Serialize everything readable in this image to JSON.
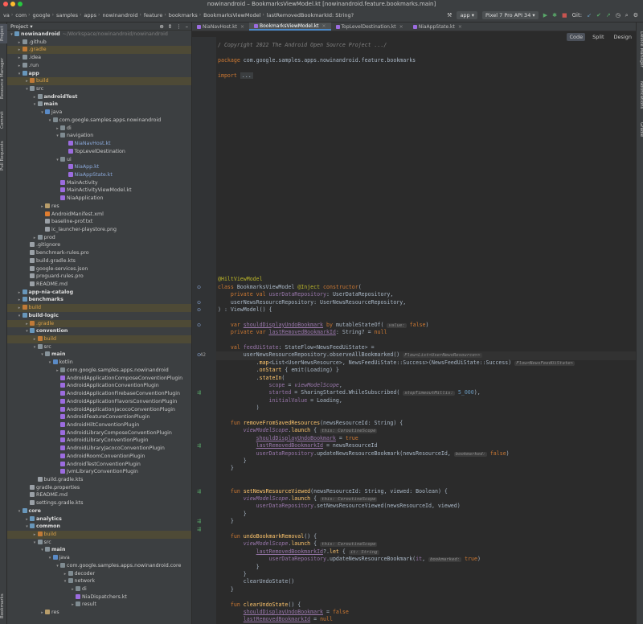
{
  "window": {
    "title": "nowinandroid – BookmarksViewModel.kt [nowinandroid.feature.bookmarks.main]"
  },
  "breadcrumbs": [
    "va",
    "com",
    "google",
    "samples",
    "apps",
    "nowinandroid",
    "feature",
    "bookmarks",
    "BookmarksViewModel",
    "lastRemovedBookmarkId: String?"
  ],
  "toolbar": {
    "run_config": "app",
    "device": "Pixel 7 Pro API 34",
    "git_label": "Git:"
  },
  "left_tabs": [
    "Project",
    "Resource Manager",
    "Commit",
    "Pull Requests",
    "Bookmarks"
  ],
  "right_tabs": [
    "Device Manager",
    "Notifications",
    "Gradle"
  ],
  "project": {
    "header": "Project",
    "tree": [
      {
        "d": 0,
        "n": "nowinandroid",
        "t": "mod",
        "h": "~/Workspace/nowinandroid/nowinandroid",
        "o": true,
        "b": true
      },
      {
        "d": 1,
        "n": ".github",
        "t": "folder",
        "o": false
      },
      {
        "d": 1,
        "n": ".gradle",
        "t": "build",
        "o": false,
        "cls": "orange",
        "x": true
      },
      {
        "d": 1,
        "n": ".idea",
        "t": "folder",
        "o": false
      },
      {
        "d": 1,
        "n": ".run",
        "t": "folder",
        "o": false
      },
      {
        "d": 1,
        "n": "app",
        "t": "mod",
        "o": true,
        "b": true
      },
      {
        "d": 2,
        "n": "build",
        "t": "build",
        "o": false,
        "cls": "orange",
        "x": true
      },
      {
        "d": 2,
        "n": "src",
        "t": "folder",
        "o": true
      },
      {
        "d": 3,
        "n": "androidTest",
        "t": "folder",
        "o": false,
        "b": true
      },
      {
        "d": 3,
        "n": "main",
        "t": "folder",
        "o": true,
        "b": true
      },
      {
        "d": 4,
        "n": "java",
        "t": "src",
        "o": true
      },
      {
        "d": 5,
        "n": "com.google.samples.apps.nowinandroid",
        "t": "pkg",
        "o": true
      },
      {
        "d": 6,
        "n": "di",
        "t": "pkg",
        "o": false
      },
      {
        "d": 6,
        "n": "navigation",
        "t": "pkg",
        "o": true
      },
      {
        "d": 7,
        "n": "NiaNavHost.kt",
        "t": "kt",
        "cls": "blue",
        "leaf": true
      },
      {
        "d": 7,
        "n": "TopLevelDestination",
        "t": "kt",
        "leaf": true
      },
      {
        "d": 6,
        "n": "ui",
        "t": "pkg",
        "o": true
      },
      {
        "d": 7,
        "n": "NiaApp.kt",
        "t": "kt",
        "cls": "blue",
        "leaf": true
      },
      {
        "d": 7,
        "n": "NiaAppState.kt",
        "t": "kt",
        "cls": "blue",
        "leaf": true
      },
      {
        "d": 6,
        "n": "MainActivity",
        "t": "kt",
        "leaf": true
      },
      {
        "d": 6,
        "n": "MainActivityViewModel.kt",
        "t": "kt",
        "leaf": true
      },
      {
        "d": 6,
        "n": "NiaApplication",
        "t": "kt",
        "leaf": true
      },
      {
        "d": 4,
        "n": "res",
        "t": "res",
        "o": false
      },
      {
        "d": 4,
        "n": "AndroidManifest.xml",
        "t": "xml",
        "leaf": true
      },
      {
        "d": 4,
        "n": "baseline-prof.txt",
        "t": "file",
        "leaf": true
      },
      {
        "d": 4,
        "n": "ic_launcher-playstore.png",
        "t": "file",
        "leaf": true
      },
      {
        "d": 3,
        "n": "prod",
        "t": "folder",
        "o": false
      },
      {
        "d": 2,
        "n": ".gitignore",
        "t": "file",
        "leaf": true
      },
      {
        "d": 2,
        "n": "benchmark-rules.pro",
        "t": "file",
        "leaf": true
      },
      {
        "d": 2,
        "n": "build.gradle.kts",
        "t": "file",
        "leaf": true
      },
      {
        "d": 2,
        "n": "google-services.json",
        "t": "file",
        "leaf": true
      },
      {
        "d": 2,
        "n": "proguard-rules.pro",
        "t": "file",
        "leaf": true
      },
      {
        "d": 2,
        "n": "README.md",
        "t": "file",
        "leaf": true
      },
      {
        "d": 1,
        "n": "app-nia-catalog",
        "t": "mod",
        "o": false,
        "b": true
      },
      {
        "d": 1,
        "n": "benchmarks",
        "t": "mod",
        "o": false,
        "b": true
      },
      {
        "d": 1,
        "n": "build",
        "t": "build",
        "o": false,
        "cls": "orange",
        "x": true
      },
      {
        "d": 1,
        "n": "build-logic",
        "t": "mod",
        "o": true,
        "b": true
      },
      {
        "d": 2,
        "n": ".gradle",
        "t": "build",
        "o": false,
        "cls": "orange",
        "x": true
      },
      {
        "d": 2,
        "n": "convention",
        "t": "mod",
        "o": true,
        "b": true
      },
      {
        "d": 3,
        "n": "build",
        "t": "build",
        "o": false,
        "cls": "orange",
        "x": true
      },
      {
        "d": 3,
        "n": "src",
        "t": "folder",
        "o": true
      },
      {
        "d": 4,
        "n": "main",
        "t": "folder",
        "o": true,
        "b": true
      },
      {
        "d": 5,
        "n": "kotlin",
        "t": "src",
        "o": true
      },
      {
        "d": 6,
        "n": "com.google.samples.apps.nowinandroid",
        "t": "pkg",
        "o": false
      },
      {
        "d": 6,
        "n": "AndroidApplicationComposeConventionPlugin",
        "t": "kt",
        "leaf": true
      },
      {
        "d": 6,
        "n": "AndroidApplicationConventionPlugin",
        "t": "kt",
        "leaf": true
      },
      {
        "d": 6,
        "n": "AndroidApplicationFirebaseConventionPlugin",
        "t": "kt",
        "leaf": true
      },
      {
        "d": 6,
        "n": "AndroidApplicationFlavorsConventionPlugin",
        "t": "kt",
        "leaf": true
      },
      {
        "d": 6,
        "n": "AndroidApplicationJacocoConventionPlugin",
        "t": "kt",
        "leaf": true
      },
      {
        "d": 6,
        "n": "AndroidFeatureConventionPlugin",
        "t": "kt",
        "leaf": true
      },
      {
        "d": 6,
        "n": "AndroidHiltConventionPlugin",
        "t": "kt",
        "leaf": true
      },
      {
        "d": 6,
        "n": "AndroidLibraryComposeConventionPlugin",
        "t": "kt",
        "leaf": true
      },
      {
        "d": 6,
        "n": "AndroidLibraryConventionPlugin",
        "t": "kt",
        "leaf": true
      },
      {
        "d": 6,
        "n": "AndroidLibraryJacocoConventionPlugin",
        "t": "kt",
        "leaf": true
      },
      {
        "d": 6,
        "n": "AndroidRoomConventionPlugin",
        "t": "kt",
        "leaf": true
      },
      {
        "d": 6,
        "n": "AndroidTestConventionPlugin",
        "t": "kt",
        "leaf": true
      },
      {
        "d": 6,
        "n": "JvmLibraryConventionPlugin",
        "t": "kt",
        "leaf": true
      },
      {
        "d": 3,
        "n": "build.gradle.kts",
        "t": "file",
        "leaf": true
      },
      {
        "d": 2,
        "n": "gradle.properties",
        "t": "file",
        "leaf": true
      },
      {
        "d": 2,
        "n": "README.md",
        "t": "file",
        "leaf": true
      },
      {
        "d": 2,
        "n": "settings.gradle.kts",
        "t": "file",
        "leaf": true
      },
      {
        "d": 1,
        "n": "core",
        "t": "mod",
        "o": true,
        "b": true
      },
      {
        "d": 2,
        "n": "analytics",
        "t": "mod",
        "o": false,
        "b": true
      },
      {
        "d": 2,
        "n": "common",
        "t": "mod",
        "o": true,
        "b": true
      },
      {
        "d": 3,
        "n": "build",
        "t": "build",
        "o": false,
        "cls": "orange",
        "x": true
      },
      {
        "d": 3,
        "n": "src",
        "t": "folder",
        "o": true
      },
      {
        "d": 4,
        "n": "main",
        "t": "folder",
        "o": true,
        "b": true
      },
      {
        "d": 5,
        "n": "java",
        "t": "src",
        "o": true
      },
      {
        "d": 6,
        "n": "com.google.samples.apps.nowinandroid.core",
        "t": "pkg",
        "o": true
      },
      {
        "d": 7,
        "n": "decoder",
        "t": "pkg",
        "o": false
      },
      {
        "d": 7,
        "n": "network",
        "t": "pkg",
        "o": true
      },
      {
        "d": 8,
        "n": "di",
        "t": "pkg",
        "o": false
      },
      {
        "d": 8,
        "n": "NiaDispatchers.kt",
        "t": "kt",
        "leaf": true
      },
      {
        "d": 8,
        "n": "result",
        "t": "pkg",
        "o": false
      },
      {
        "d": 4,
        "n": "res",
        "t": "res",
        "o": false
      }
    ]
  },
  "tabs": [
    {
      "label": "NiaNavHost.kt",
      "active": false
    },
    {
      "label": "BookmarksViewModel.kt",
      "active": true
    },
    {
      "label": "TopLevelDestination.kt",
      "active": false
    },
    {
      "label": "NiaAppState.kt",
      "active": false
    }
  ],
  "view_modes": [
    "Code",
    "Split",
    "Design"
  ],
  "code": {
    "first_line": 1,
    "current_line": 42,
    "lines": [
      [
        [
          "c",
          "/ Copyright 2022 The Android Open Source Project .../"
        ]
      ],
      [],
      [
        [
          "k",
          "package "
        ],
        [
          "t",
          "com.google.samples.apps.nowinandroid.feature.bookmarks"
        ]
      ],
      [],
      [
        [
          "k",
          "import "
        ],
        [
          "fold",
          "..."
        ]
      ],
      [],
      [],
      [],
      [],
      [],
      [],
      [],
      [],
      [],
      [],
      [],
      [],
      [],
      [],
      [],
      [],
      [],
      [],
      [],
      [],
      [],
      [],
      [],
      [],
      [],
      [],
      [
        [
          "a",
          "@HiltViewModel"
        ]
      ],
      [
        [
          "k",
          "class "
        ],
        [
          "t",
          "BookmarksViewModel "
        ],
        [
          "a",
          "@Inject "
        ],
        [
          "k",
          "constructor"
        ],
        [
          "t",
          "("
        ]
      ],
      [
        [
          "t",
          "    "
        ],
        [
          "k",
          "private val "
        ],
        [
          "p",
          "userDataRepository"
        ],
        [
          "t",
          ": UserDataRepository,"
        ]
      ],
      [
        [
          "t",
          "    userNewsResourceRepository: UserNewsResourceRepository,"
        ]
      ],
      [
        [
          "t",
          ") : ViewModel() {"
        ]
      ],
      [],
      [
        [
          "t",
          "    "
        ],
        [
          "k",
          "var "
        ],
        [
          "pu",
          "shouldDisplayUndoBookmark"
        ],
        [
          "t",
          " "
        ],
        [
          "k",
          "by "
        ],
        [
          "t",
          "mutableStateOf( "
        ],
        [
          "hl",
          "value:"
        ],
        [
          "t",
          " "
        ],
        [
          "k",
          "false"
        ],
        [
          "t",
          ")"
        ]
      ],
      [
        [
          "t",
          "    "
        ],
        [
          "k",
          "private var "
        ],
        [
          "pu",
          "lastRemovedBookmarkId"
        ],
        [
          "t",
          ": String? = "
        ],
        [
          "k",
          "null"
        ]
      ],
      [],
      [
        [
          "t",
          "    "
        ],
        [
          "k",
          "val "
        ],
        [
          "p",
          "feedUiState"
        ],
        [
          "t",
          ": StateFlow<NewsFeedUiState> ="
        ]
      ],
      [
        [
          "t",
          "        userNewsResourceRepository.observeAllBookmarked() "
        ],
        [
          "hl",
          "Flow<List<UserNewsResource>>"
        ]
      ],
      [
        [
          "t",
          "            ."
        ],
        [
          "f",
          "map"
        ],
        [
          "t",
          "<List<UserNewsResource>, NewsFeedUiState::Success>(NewsFeedUiState::Success) "
        ],
        [
          "hl",
          "Flow<NewsFeedUiState>"
        ]
      ],
      [
        [
          "t",
          "            ."
        ],
        [
          "f",
          "onStart"
        ],
        [
          "t",
          " { emit(Loading) }"
        ]
      ],
      [
        [
          "t",
          "            ."
        ],
        [
          "f",
          "stateIn"
        ],
        [
          "t",
          "("
        ]
      ],
      [
        [
          "t",
          "                "
        ],
        [
          "p",
          "scope"
        ],
        [
          "t",
          " = "
        ],
        [
          "pi",
          "viewModelScope"
        ],
        [
          "t",
          ","
        ]
      ],
      [
        [
          "t",
          "                "
        ],
        [
          "p",
          "started"
        ],
        [
          "t",
          " = SharingStarted.WhileSubscribed( "
        ],
        [
          "hl",
          "stopTimeoutMillis:"
        ],
        [
          "t",
          " "
        ],
        [
          "n",
          "5_000"
        ],
        [
          "t",
          "),"
        ]
      ],
      [
        [
          "t",
          "                "
        ],
        [
          "p",
          "initialValue"
        ],
        [
          "t",
          " = Loading,"
        ]
      ],
      [
        [
          "t",
          "            )"
        ]
      ],
      [],
      [
        [
          "t",
          "    "
        ],
        [
          "k",
          "fun "
        ],
        [
          "f",
          "removeFromSavedResources"
        ],
        [
          "t",
          "(newsResourceId: String) {"
        ]
      ],
      [
        [
          "t",
          "        "
        ],
        [
          "pi",
          "viewModelScope"
        ],
        [
          "t",
          "."
        ],
        [
          "f",
          "launch"
        ],
        [
          "t",
          " { "
        ],
        [
          "hl",
          "this: CoroutineScope"
        ]
      ],
      [
        [
          "t",
          "            "
        ],
        [
          "pu",
          "shouldDisplayUndoBookmark"
        ],
        [
          "t",
          " = "
        ],
        [
          "k",
          "true"
        ]
      ],
      [
        [
          "t",
          "            "
        ],
        [
          "pu",
          "lastRemovedBookmarkId"
        ],
        [
          "t",
          " = newsResourceId"
        ]
      ],
      [
        [
          "t",
          "            "
        ],
        [
          "p",
          "userDataRepository"
        ],
        [
          "t",
          ".updateNewsResourceBookmark(newsResourceId, "
        ],
        [
          "hl",
          "bookmarked:"
        ],
        [
          "t",
          " "
        ],
        [
          "k",
          "false"
        ],
        [
          "t",
          ")"
        ]
      ],
      [
        [
          "t",
          "        }"
        ]
      ],
      [
        [
          "t",
          "    }"
        ]
      ],
      [],
      [],
      [
        [
          "t",
          "    "
        ],
        [
          "k",
          "fun "
        ],
        [
          "f",
          "setNewsResourceViewed"
        ],
        [
          "t",
          "(newsResourceId: String, viewed: Boolean) {"
        ]
      ],
      [
        [
          "t",
          "        "
        ],
        [
          "pi",
          "viewModelScope"
        ],
        [
          "t",
          "."
        ],
        [
          "f",
          "launch"
        ],
        [
          "t",
          " { "
        ],
        [
          "hl",
          "this: CoroutineScope"
        ]
      ],
      [
        [
          "t",
          "            "
        ],
        [
          "p",
          "userDataRepository"
        ],
        [
          "t",
          ".setNewsResourceViewed(newsResourceId, viewed)"
        ]
      ],
      [
        [
          "t",
          "        }"
        ]
      ],
      [
        [
          "t",
          "    }"
        ]
      ],
      [],
      [
        [
          "t",
          "    "
        ],
        [
          "k",
          "fun "
        ],
        [
          "f",
          "undoBookmarkRemoval"
        ],
        [
          "t",
          "() {"
        ]
      ],
      [
        [
          "t",
          "        "
        ],
        [
          "pi",
          "viewModelScope"
        ],
        [
          "t",
          "."
        ],
        [
          "f",
          "launch"
        ],
        [
          "t",
          " { "
        ],
        [
          "hl",
          "this: CoroutineScope"
        ]
      ],
      [
        [
          "t",
          "            "
        ],
        [
          "pu",
          "lastRemovedBookmarkId"
        ],
        [
          "t",
          "?."
        ],
        [
          "f",
          "let"
        ],
        [
          "t",
          " { "
        ],
        [
          "hl",
          "it: String"
        ]
      ],
      [
        [
          "t",
          "                "
        ],
        [
          "p",
          "userDataRepository"
        ],
        [
          "t",
          ".updateNewsResourceBookmark("
        ],
        [
          "p",
          "it"
        ],
        [
          "t",
          ", "
        ],
        [
          "hl",
          "bookmarked:"
        ],
        [
          "t",
          " "
        ],
        [
          "k",
          "true"
        ],
        [
          "t",
          ")"
        ]
      ],
      [
        [
          "t",
          "            }"
        ]
      ],
      [
        [
          "t",
          "        }"
        ]
      ],
      [
        [
          "t",
          "        clearUndoState()"
        ]
      ],
      [
        [
          "t",
          "    }"
        ]
      ],
      [],
      [
        [
          "t",
          "    "
        ],
        [
          "k",
          "fun "
        ],
        [
          "f",
          "clearUndoState"
        ],
        [
          "t",
          "() {"
        ]
      ],
      [
        [
          "t",
          "        "
        ],
        [
          "pu",
          "shouldDisplayUndoBookmark"
        ],
        [
          "t",
          " = "
        ],
        [
          "k",
          "false"
        ]
      ],
      [
        [
          "t",
          "        "
        ],
        [
          "pu",
          "lastRemovedBookmarkId"
        ],
        [
          "t",
          " = "
        ],
        [
          "k",
          "null"
        ]
      ],
      [
        [
          "t",
          "    }"
        ]
      ],
      [
        [
          "t",
          "}"
        ]
      ],
      []
    ]
  }
}
